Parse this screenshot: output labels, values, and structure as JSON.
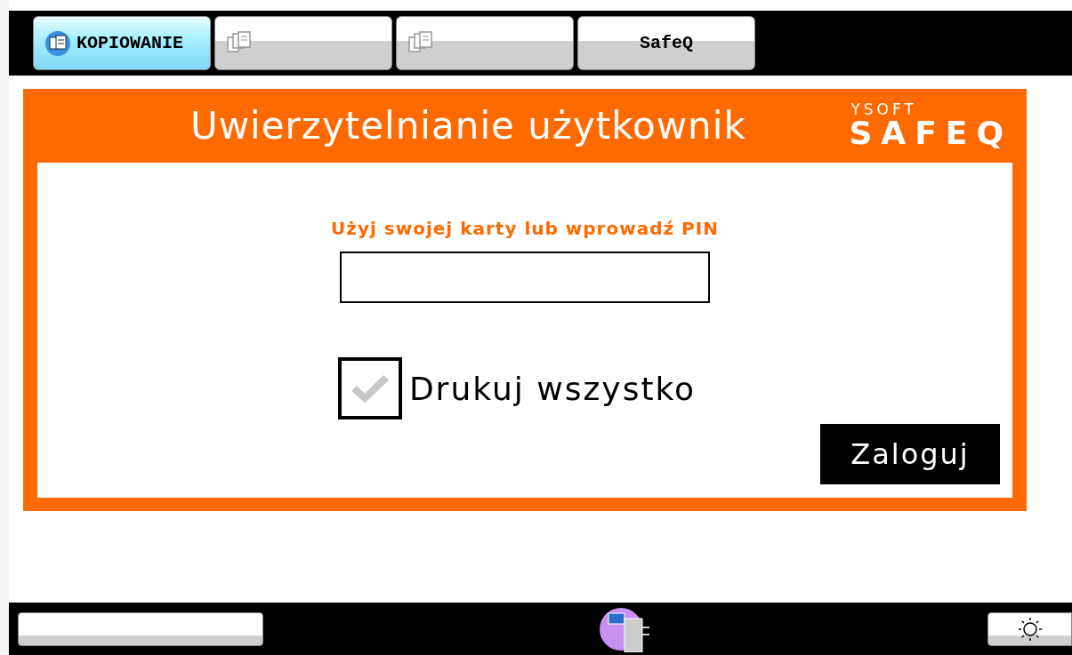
{
  "tabs": [
    {
      "kind": "copy",
      "label": "KOPIOWANIE",
      "selected": true
    },
    {
      "kind": "documents",
      "selected": false
    },
    {
      "kind": "documents",
      "selected": false
    },
    {
      "kind": "text",
      "label": "SafeQ",
      "selected": false
    }
  ],
  "dialog": {
    "title": "Uwierzytelnianie użytkownik",
    "logo_top": "YSOFT",
    "logo_main": "SAFEQ",
    "prompt": "Użyj swojej karty lub wprowadź PIN",
    "print_all": {
      "label": "Drukuj wszystko",
      "checked": false
    },
    "login_button": "Zaloguj"
  },
  "bottom_bar": {
    "right_button": {
      "kind": "brightness"
    }
  }
}
